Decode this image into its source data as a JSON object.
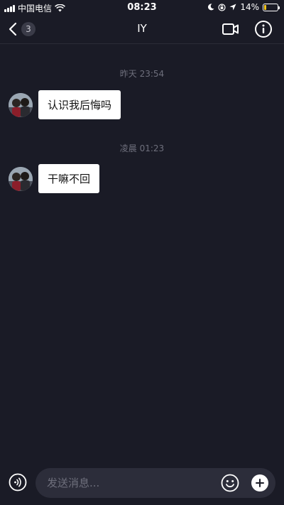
{
  "status_bar": {
    "carrier": "中国电信",
    "time": "08:23",
    "battery_percent": "14%",
    "battery_level": 0.14,
    "icons": [
      "signal-icon",
      "wifi-icon",
      "moon-icon",
      "lock-rotation-icon",
      "location-icon",
      "battery-icon"
    ]
  },
  "nav": {
    "unread_count": "3",
    "title": "IY",
    "icons": [
      "back-chevron-icon",
      "video-camera-icon",
      "info-icon"
    ]
  },
  "messages": [
    {
      "timestamp": "昨天 23:54",
      "text": "认识我后悔吗"
    },
    {
      "timestamp": "凌晨 01:23",
      "text": "干嘛不回"
    }
  ],
  "input": {
    "placeholder": "发送消息...",
    "value": "",
    "icons": [
      "voice-icon",
      "emoji-icon",
      "plus-icon"
    ]
  },
  "colors": {
    "background": "#1a1b26",
    "bubble": "#ffffff",
    "input_bg": "#2c2d3a",
    "battery_accent": "#f5c518"
  }
}
